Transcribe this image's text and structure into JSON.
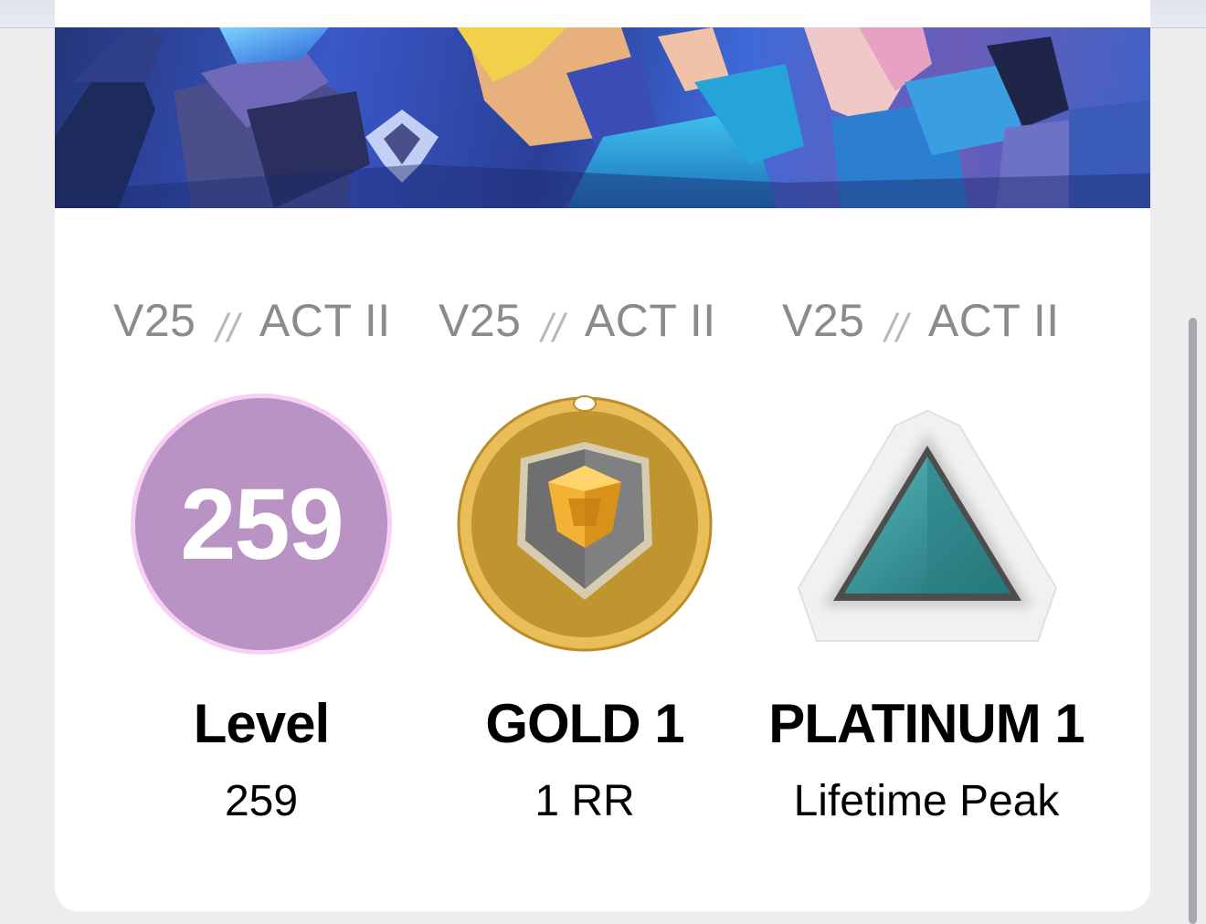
{
  "cards": [
    {
      "season": "V25",
      "separator": "//",
      "act": "ACT II",
      "badge_value": "259",
      "title": "Level",
      "subtitle": "259",
      "icon": "level-badge"
    },
    {
      "season": "V25",
      "separator": "//",
      "act": "ACT II",
      "title": "GOLD 1",
      "subtitle": "1 RR",
      "icon": "gold-rank-icon"
    },
    {
      "season": "V25",
      "separator": "//",
      "act": "ACT II",
      "title": "PLATINUM 1",
      "subtitle": "Lifetime Peak",
      "icon": "platinum-rank-icon"
    }
  ],
  "colors": {
    "level_badge_fill": "#b893c3",
    "level_badge_ring": "#f8d0f6",
    "gold": "#e2b34a",
    "platinum": "#2f8f92"
  }
}
